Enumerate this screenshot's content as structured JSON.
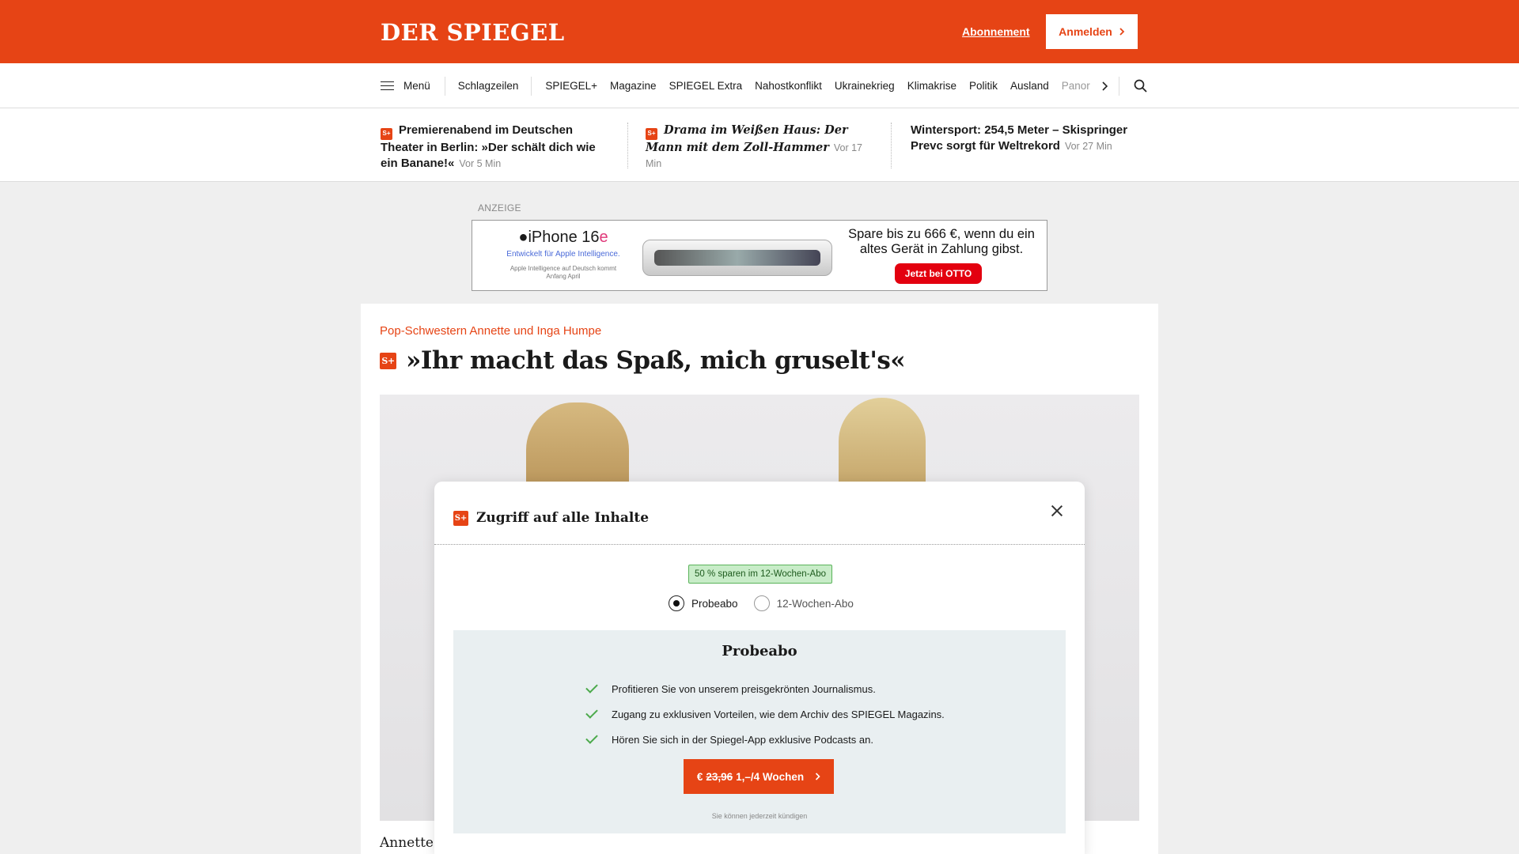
{
  "header": {
    "logo": "DER SPIEGEL",
    "subscription_link": "Abonnement",
    "login_button": "Anmelden",
    "accent_color": "#e64415"
  },
  "nav": {
    "menu_label": "Menü",
    "items": [
      "Schlagzeilen",
      "SPIEGEL+",
      "Magazine",
      "SPIEGEL Extra",
      "Nahostkonflikt",
      "Ukrainekrieg",
      "Klimakrise",
      "Politik",
      "Ausland",
      "Panor"
    ],
    "active": "Schlagzeilen"
  },
  "teasers": [
    {
      "badge": "S+",
      "title": "Premierenabend im Deutschen Theater in Berlin: »Der schält dich wie ein Banane!«",
      "time": "Vor 5 Min"
    },
    {
      "badge": "S+",
      "title": "Drama im Weißen Haus: Der Mann mit dem Zoll-Hammer",
      "time": "Vor 17 Min"
    },
    {
      "title": "Wintersport: 254,5 Meter – Skispringer Prevc sorgt für Weltrekord",
      "time": "Vor 27 Min"
    }
  ],
  "ad": {
    "label": "ANZEIGE",
    "product": "iPhone 16",
    "product_suffix": "e",
    "tagline": "Entwickelt für Apple Intelligence.",
    "fine_print": "Apple Intelligence auf Deutsch kommt Anfang April",
    "copy": "Spare bis zu 666 €, wenn du ein altes Gerät in Zahlung gibst.",
    "cta": "Jetzt bei OTTO"
  },
  "article": {
    "kicker": "Pop-Schwestern Annette und Inga Humpe",
    "badge": "S+",
    "headline": "»Ihr macht das Spaß, mich gruselt's«",
    "caption_start": "Annette"
  },
  "modal": {
    "badge": "S+",
    "title": "Zugriff auf alle Inhalte",
    "savings_badge": "50 % sparen im 12-Wochen-Abo",
    "options": [
      {
        "label": "Probeabo",
        "selected": true
      },
      {
        "label": "12-Wochen-Abo",
        "selected": false
      }
    ],
    "plan": {
      "title": "Probeabo",
      "benefits": [
        "Profitieren Sie von unserem preisgekrönten Journalismus.",
        "Zugang zu exklusiven Vorteilen, wie dem Archiv des SPIEGEL Magazins.",
        "Hören Sie sich in der Spiegel-App exklusive Podcasts an."
      ],
      "cta_currency": "€",
      "cta_old_price": "23,96",
      "cta_price": "1,–/4 Wochen",
      "cancel_note": "Sie können jederzeit kündigen"
    }
  }
}
